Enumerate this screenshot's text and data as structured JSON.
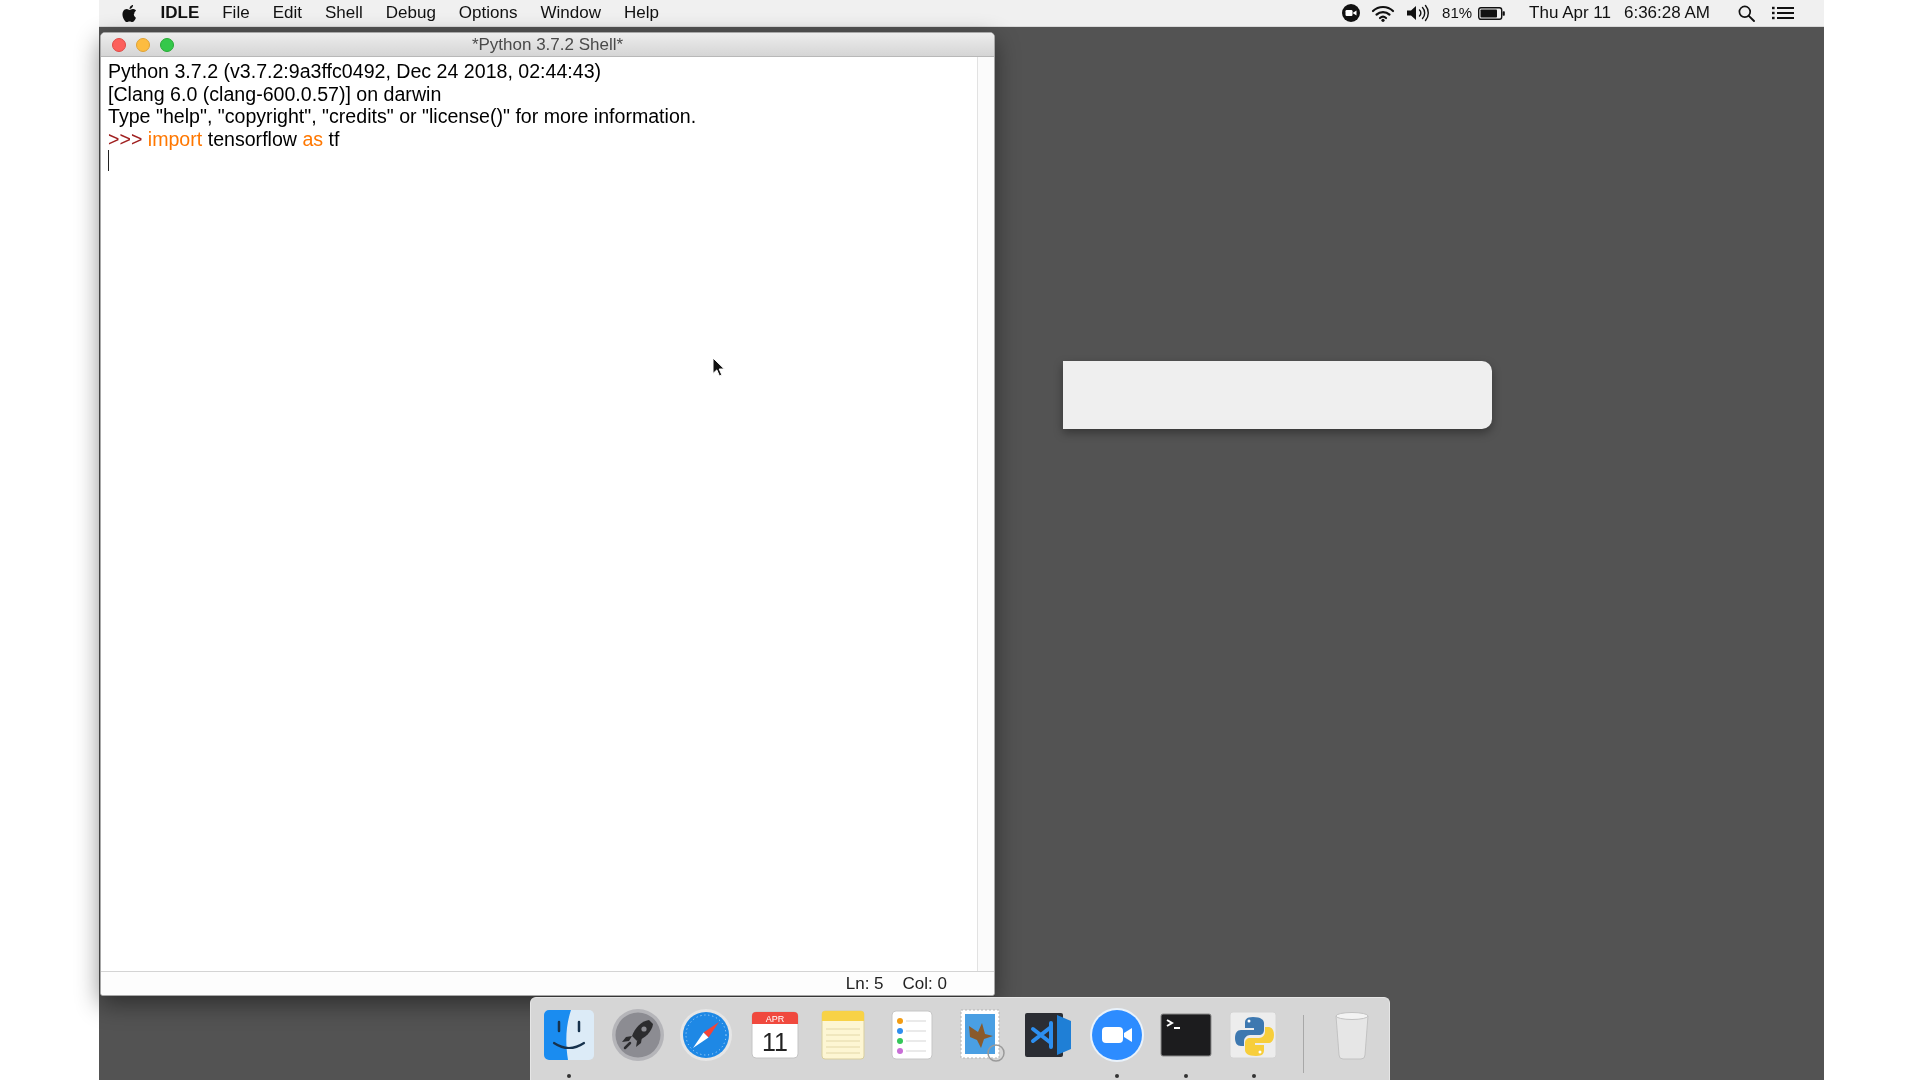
{
  "menu_bar": {
    "app_name": "IDLE",
    "menus": [
      "File",
      "Edit",
      "Shell",
      "Debug",
      "Options",
      "Window",
      "Help"
    ],
    "status": {
      "battery": "81%",
      "date": "Thu Apr 11",
      "time": "6:36:28 AM"
    }
  },
  "shell_window": {
    "title": "*Python 3.7.2 Shell*",
    "lines": [
      {
        "kind": "output",
        "text": "Python 3.7.2 (v3.7.2:9a3ffc0492, Dec 24 2018, 02:44:43)"
      },
      {
        "kind": "output",
        "text": "[Clang 6.0 (clang-600.0.57)] on darwin"
      },
      {
        "kind": "output",
        "text": "Type \"help\", \"copyright\", \"credits\" or \"license()\" for more information."
      },
      {
        "kind": "input",
        "prompt": ">>>",
        "tokens": [
          {
            "kind": "keyword",
            "text": "import"
          },
          {
            "kind": "name",
            "text": "tensorflow"
          },
          {
            "kind": "keyword",
            "text": "as"
          },
          {
            "kind": "name",
            "text": "tf"
          }
        ]
      }
    ],
    "status_bar": {
      "line": "Ln: 5",
      "column": "Col: 0"
    }
  },
  "dock": {
    "apps": [
      {
        "kind": "finder",
        "running": true
      },
      {
        "kind": "launchpad",
        "running": false
      },
      {
        "kind": "safari",
        "running": false
      },
      {
        "kind": "calendar",
        "month": "APR",
        "day": "11",
        "running": false
      },
      {
        "kind": "notes",
        "running": false
      },
      {
        "kind": "reminders",
        "running": false
      },
      {
        "kind": "mail",
        "running": false
      },
      {
        "kind": "editor",
        "running": false
      },
      {
        "kind": "zoom",
        "running": true
      },
      {
        "kind": "terminal",
        "running": true
      },
      {
        "kind": "python",
        "running": true
      }
    ]
  }
}
